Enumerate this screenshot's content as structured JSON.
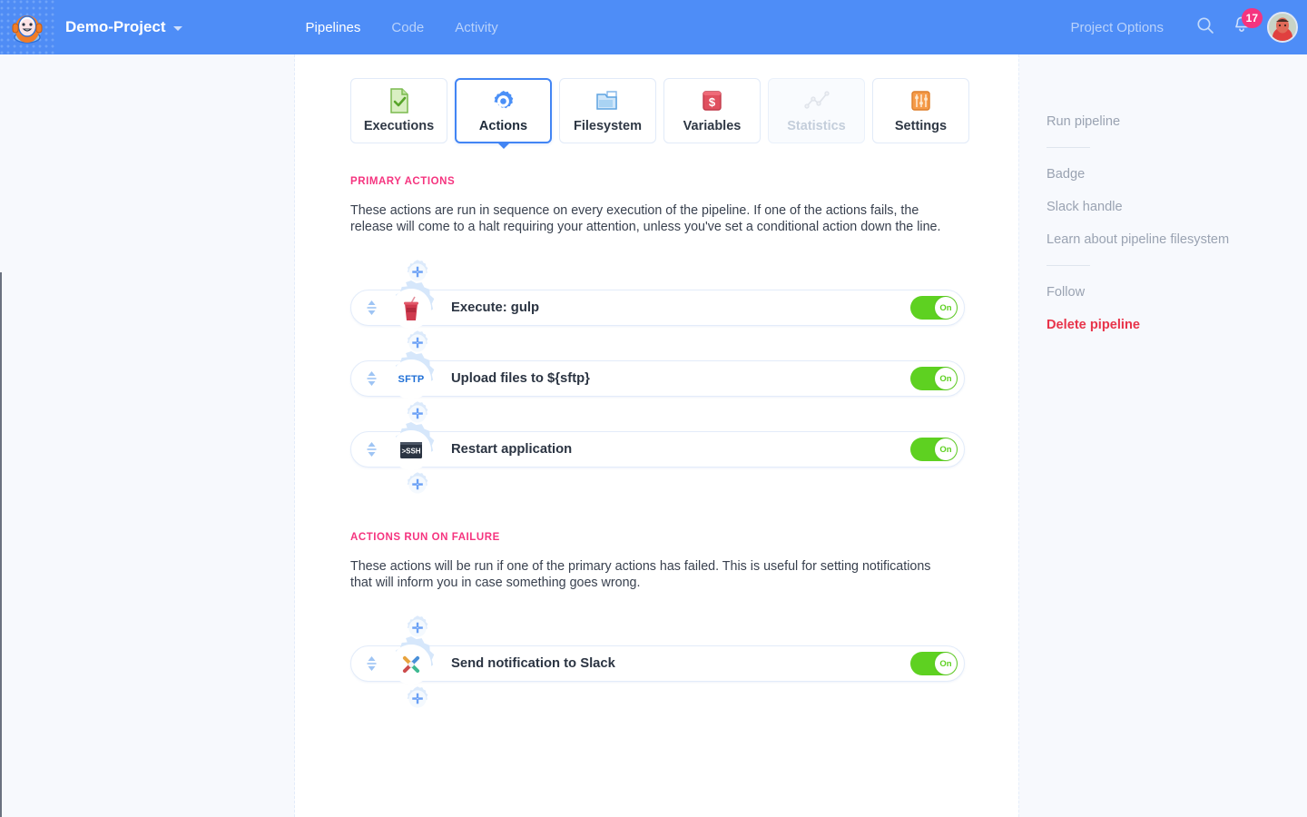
{
  "colors": {
    "brand_blue": "#4e8df7",
    "accent_pink": "#f5347f",
    "toggle_green": "#5ed121",
    "danger_red": "#e8344a",
    "tab_active_border": "#4285f4"
  },
  "topbar": {
    "logo_icon": "buddy-mascot-logo-icon",
    "project_name": "Demo-Project",
    "project_caret_icon": "chevron-down-icon",
    "nav_links": [
      {
        "label": "Pipelines",
        "active": true
      },
      {
        "label": "Code",
        "active": false
      },
      {
        "label": "Activity",
        "active": false
      }
    ],
    "project_options_label": "Project Options",
    "search_icon": "search-icon",
    "notifications_icon": "bell-icon",
    "notifications_count": "17",
    "avatar_icon": "user-avatar"
  },
  "tabs": [
    {
      "label": "Executions",
      "icon": "document-check-icon",
      "active": false,
      "disabled": false
    },
    {
      "label": "Actions",
      "icon": "gear-icon",
      "active": true,
      "disabled": false
    },
    {
      "label": "Filesystem",
      "icon": "folder-files-icon",
      "active": false,
      "disabled": false
    },
    {
      "label": "Variables",
      "icon": "dollar-box-icon",
      "active": false,
      "disabled": false
    },
    {
      "label": "Statistics",
      "icon": "line-chart-icon",
      "active": false,
      "disabled": true
    },
    {
      "label": "Settings",
      "icon": "sliders-icon",
      "active": false,
      "disabled": false
    }
  ],
  "sections": [
    {
      "title": "PRIMARY ACTIONS",
      "description": "These actions are run in sequence on every execution of the pipeline. If one of the actions fails, the release will come to a halt requiring your attention, unless you've set a conditional action down the line.",
      "actions": [
        {
          "title": "Execute: gulp",
          "icon": "gulp-icon",
          "toggle_label": "On",
          "toggle_on": true
        },
        {
          "title": "Upload files to ${sftp}",
          "icon": "sftp-icon",
          "toggle_label": "On",
          "toggle_on": true
        },
        {
          "title": "Restart application",
          "icon": "ssh-terminal-icon",
          "toggle_label": "On",
          "toggle_on": true
        }
      ]
    },
    {
      "title": "ACTIONS RUN ON FAILURE",
      "description": "These actions will be run if one of the primary actions has failed. This is useful for setting notifications that will inform you in case something goes wrong.",
      "actions": [
        {
          "title": "Send notification to Slack",
          "icon": "slack-icon",
          "toggle_label": "On",
          "toggle_on": true
        }
      ]
    }
  ],
  "add_action_icon": "add-action-gear-icon",
  "drag_handle_icon": "drag-updown-icon",
  "right_rail": {
    "groups": [
      {
        "links": [
          {
            "label": "Run pipeline",
            "danger": false
          }
        ]
      },
      {
        "links": [
          {
            "label": "Badge",
            "danger": false
          },
          {
            "label": "Slack handle",
            "danger": false
          },
          {
            "label": "Learn about pipeline filesystem",
            "danger": false
          }
        ]
      },
      {
        "links": [
          {
            "label": "Follow",
            "danger": false
          },
          {
            "label": "Delete pipeline",
            "danger": true
          }
        ]
      }
    ]
  }
}
